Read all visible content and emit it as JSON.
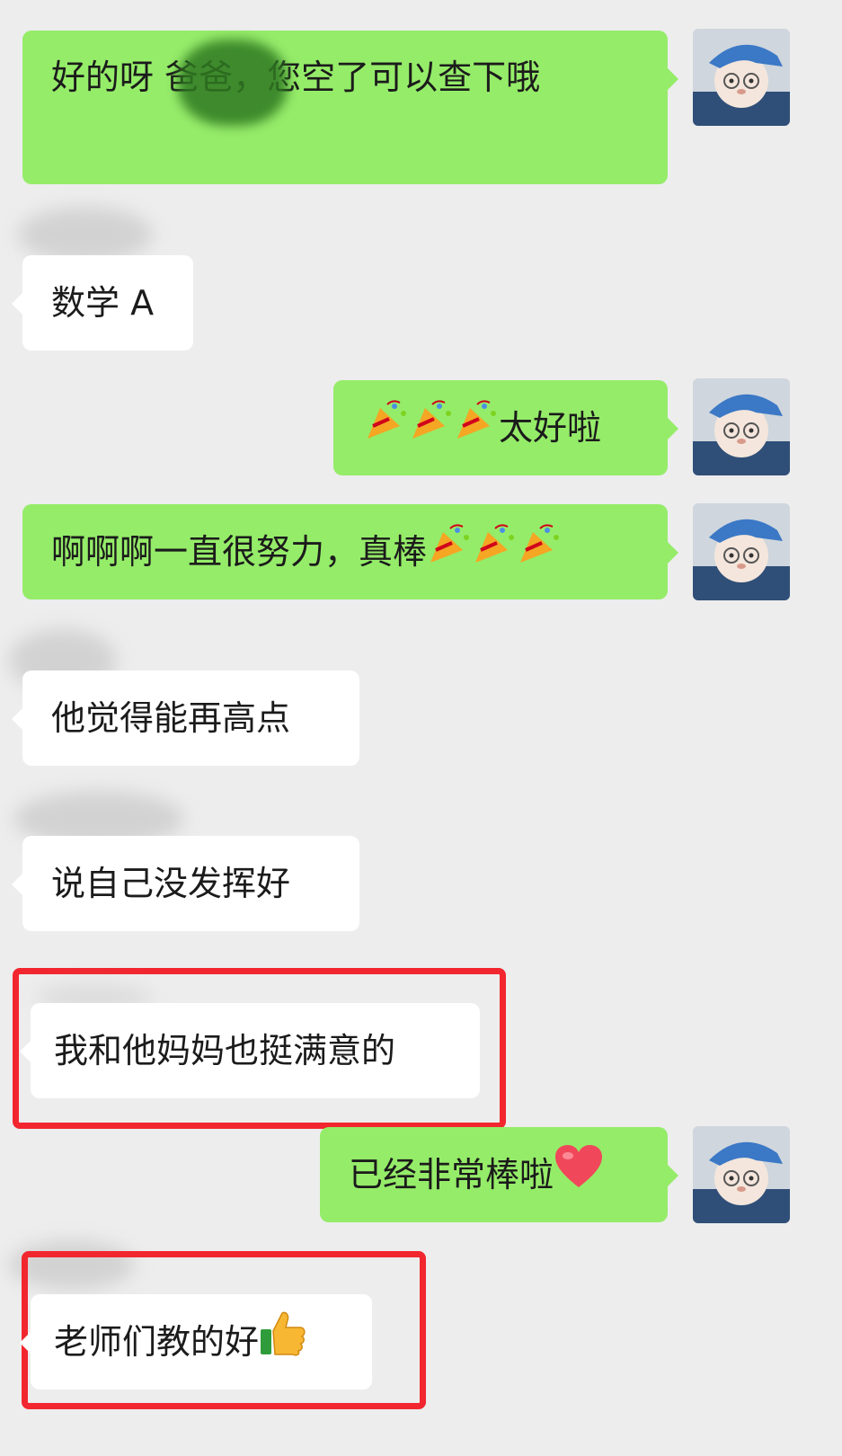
{
  "messages": {
    "m1": {
      "text": "好的呀        爸爸，您空了可以查下哦"
    },
    "m2": {
      "text": "数学 A"
    },
    "m3": {
      "text": "太好啦"
    },
    "m4": {
      "text": "啊啊啊一直很努力，真棒"
    },
    "m5": {
      "text": "他觉得能再高点"
    },
    "m6": {
      "text": "说自己没发挥好"
    },
    "m7": {
      "text": "我和他妈妈也挺满意的"
    },
    "m8": {
      "text": "已经非常棒啦"
    },
    "m9": {
      "text": "老师们教的好"
    }
  },
  "icons": {
    "party": "party-popper-icon",
    "heart": "red-heart-icon",
    "thumbs": "thumbs-up-icon",
    "avatar": "plush-bear-avatar"
  },
  "colors": {
    "background": "#ededed",
    "outgoing_bubble": "#95ec69",
    "incoming_bubble": "#ffffff",
    "highlight_box": "#f2262f"
  }
}
